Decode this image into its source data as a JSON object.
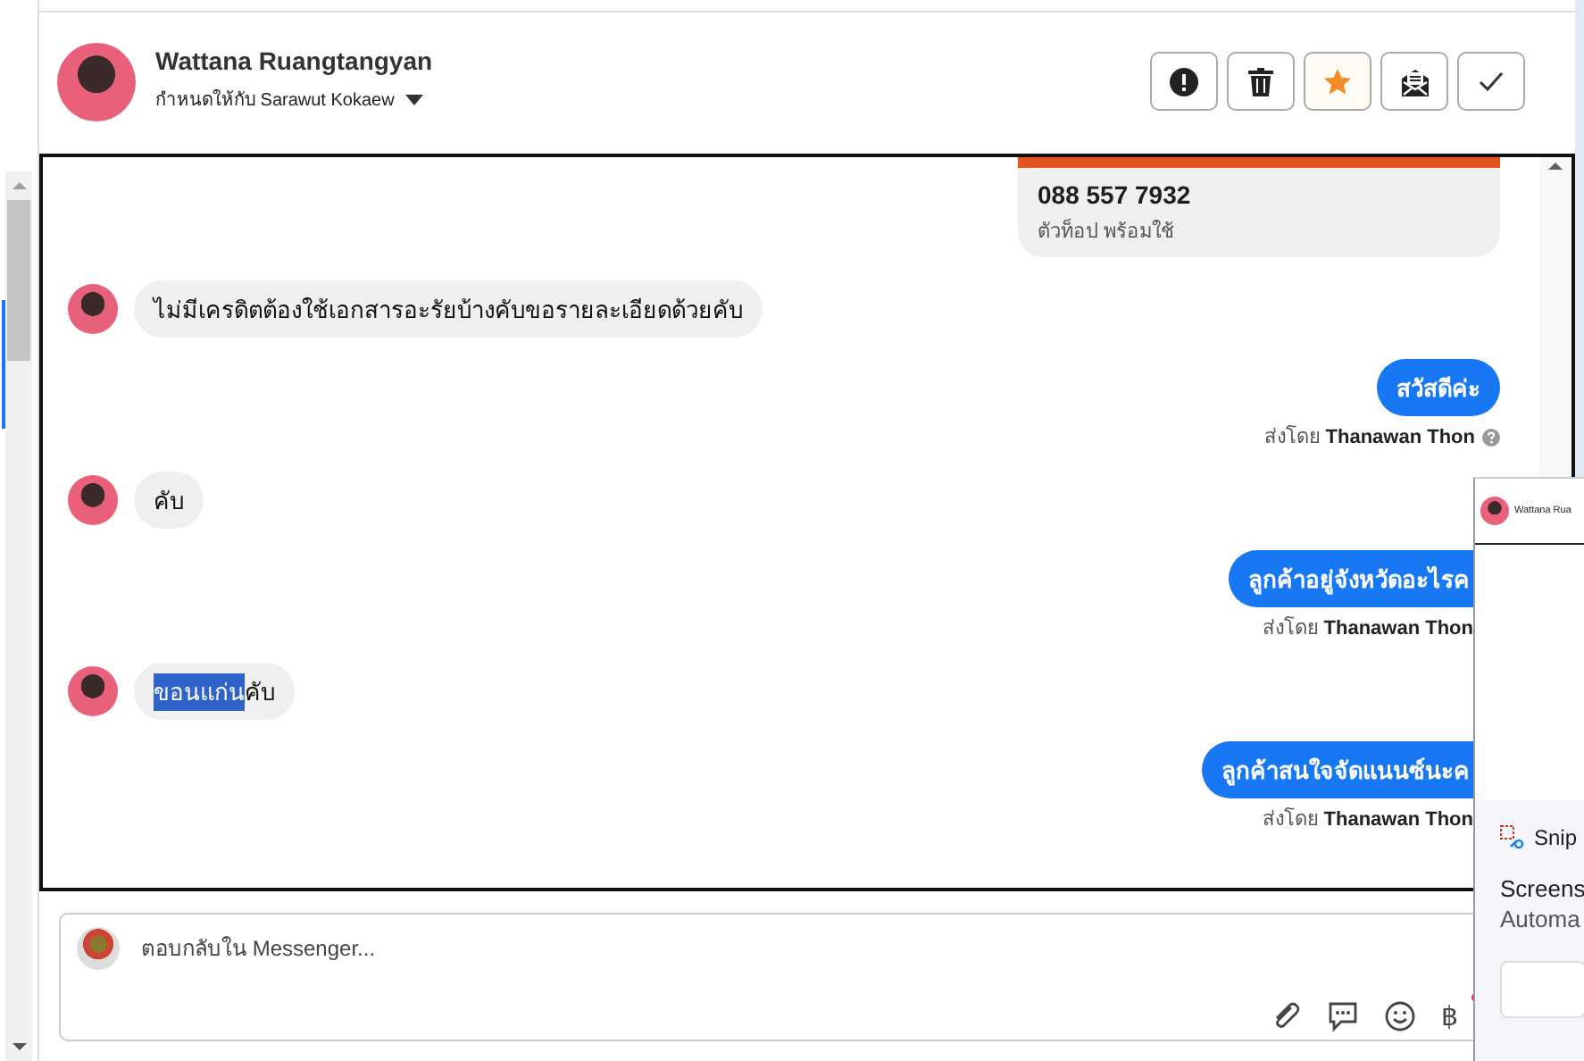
{
  "conversation_header": {
    "name": "Wattana Ruangtangyan",
    "assigned_to": "กำหนดให้กับ Sarawut Kokaew"
  },
  "header_actions": [
    {
      "kind": "alert",
      "selected": false
    },
    {
      "kind": "trash",
      "selected": false
    },
    {
      "kind": "star",
      "selected": true
    },
    {
      "kind": "spam",
      "selected": false
    },
    {
      "kind": "done",
      "selected": false
    }
  ],
  "messages": [
    {
      "kind": "image-card",
      "title": "088 557 7932",
      "subtitle": "ตัวท็อป พร้อมใช้"
    },
    {
      "kind": "incoming",
      "parts": [
        {
          "text": "ไม่มีเครดิตต้องใช้เอกสารอะรัยบ้างคับขอรายละเอียดด้วยคับ",
          "selected": false
        }
      ]
    },
    {
      "kind": "outgoing",
      "parts": [
        {
          "text": "สวัสดีค่ะ",
          "selected": false
        }
      ],
      "sender": "ส่งโดย **Thanawan Thon**",
      "help_icon": true
    },
    {
      "kind": "incoming",
      "parts": [
        {
          "text": "คับ",
          "selected": false
        }
      ]
    },
    {
      "kind": "outgoing-clipped",
      "parts": [
        {
          "text": "ลูกค้าอยู่จังหวัดอะไรค",
          "selected": false
        }
      ],
      "sender": "ส่งโดย **Thanawan Thon**",
      "help_icon": false
    },
    {
      "kind": "incoming",
      "parts": [
        {
          "text": "ขอนแก่น",
          "selected": true
        },
        {
          "text": "คับ",
          "selected": false
        }
      ]
    },
    {
      "kind": "outgoing-clipped",
      "parts": [
        {
          "text": "ลูกค้าสนใจจัดแนนซ์นะค",
          "selected": false
        }
      ],
      "sender": "ส่งโดย **Thanawan Thon**",
      "help_icon": false
    }
  ],
  "composer": {
    "placeholder": "ตอบกลับใน Messenger...",
    "currency_button": "฿"
  },
  "snip_overlay": {
    "preview_title": "Wattana Rua",
    "app_name": "Snip",
    "line_1": "Screens",
    "line_2": "Automa"
  }
}
